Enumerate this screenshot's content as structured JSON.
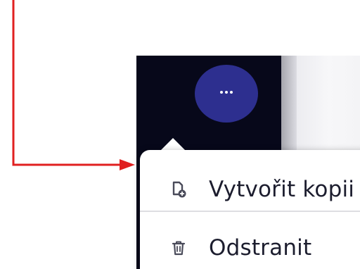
{
  "annotation": {
    "arrow_color": "#e02020"
  },
  "app": {
    "background_color": "#07081a",
    "more_button": {
      "icon": "more-horizontal-icon",
      "color": "#2d2f8f"
    }
  },
  "menu": {
    "items": [
      {
        "label": "Vytvořit kopii",
        "icon": "copy-file-icon"
      },
      {
        "label": "Odstranit",
        "icon": "trash-icon"
      }
    ]
  }
}
